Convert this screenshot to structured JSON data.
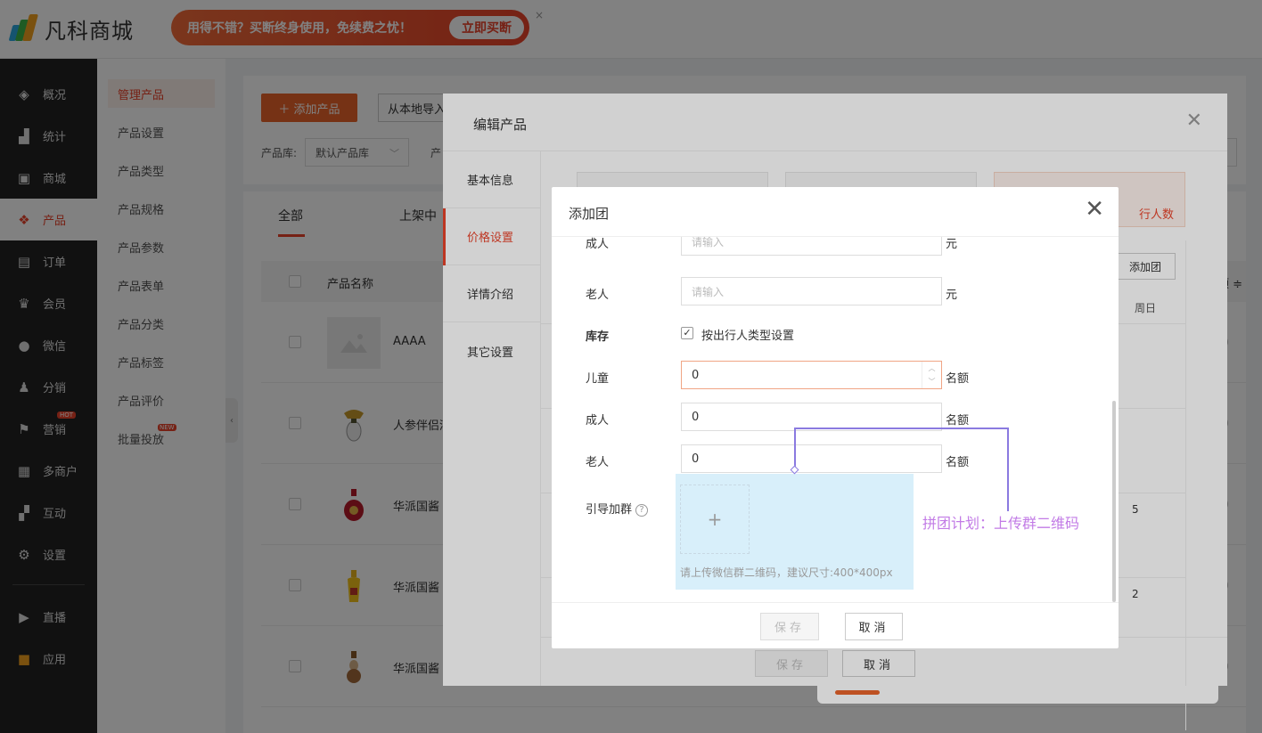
{
  "brand": {
    "name": "凡科商城"
  },
  "banner": {
    "text": "用得不错？买断终身使用，免续费之忧！",
    "button": "立即买断",
    "close": "×"
  },
  "nav": [
    {
      "label": "概况",
      "icon": "layers-icon",
      "glyph": "◈"
    },
    {
      "label": "统计",
      "icon": "chart-icon",
      "glyph": "▟"
    },
    {
      "label": "商城",
      "icon": "store-icon",
      "glyph": "▣"
    },
    {
      "label": "产品",
      "icon": "product-grid-icon",
      "glyph": "❖"
    },
    {
      "label": "订单",
      "icon": "order-icon",
      "glyph": "▤"
    },
    {
      "label": "会员",
      "icon": "crown-icon",
      "glyph": "♛"
    },
    {
      "label": "微信",
      "icon": "wechat-icon",
      "glyph": "●"
    },
    {
      "label": "分销",
      "icon": "users-icon",
      "glyph": "♟"
    },
    {
      "label": "营销",
      "icon": "flag-icon",
      "glyph": "⚑",
      "badge": "HOT"
    },
    {
      "label": "多商户",
      "icon": "merchant-icon",
      "glyph": "▦"
    },
    {
      "label": "互动",
      "icon": "interact-icon",
      "glyph": "▞"
    },
    {
      "label": "设置",
      "icon": "gear-icon",
      "glyph": "⚙"
    },
    {
      "label": "直播",
      "icon": "live-tv-icon",
      "glyph": "▶"
    },
    {
      "label": "应用",
      "icon": "apps-icon",
      "glyph": "■"
    }
  ],
  "subnav": [
    {
      "label": "管理产品"
    },
    {
      "label": "产品设置"
    },
    {
      "label": "产品类型"
    },
    {
      "label": "产品规格"
    },
    {
      "label": "产品参数"
    },
    {
      "label": "产品表单"
    },
    {
      "label": "产品分类"
    },
    {
      "label": "产品标签"
    },
    {
      "label": "产品评价"
    },
    {
      "label": "批量投放",
      "badge": "NEW"
    }
  ],
  "toolbar": {
    "add_label": "＋ 添加产品",
    "import_label": "从本地导入",
    "lib_label": "产品库:",
    "lib_value": "默认产品库",
    "lib2_label": "产"
  },
  "tabs": {
    "all": "全部",
    "on_sale": "上架中"
  },
  "table": {
    "col_name": "产品名称",
    "col_right": "顶 ≑",
    "rows": [
      {
        "name": "AAAA",
        "icon": "image-placeholder-icon"
      },
      {
        "name": "人参伴侣酒",
        "icon": "ginseng-bottle-icon"
      },
      {
        "name": "华派国酱",
        "icon": "red-bottle-icon"
      },
      {
        "name": "华派国酱",
        "icon": "yellow-bottle-icon"
      },
      {
        "name": "华派国酱",
        "icon": "brown-bottle-icon"
      }
    ]
  },
  "edit_modal": {
    "title": "编辑产品",
    "tabs": [
      "基本信息",
      "价格设置",
      "详情介绍",
      "其它设置"
    ],
    "card_hot_text": "行人数",
    "add_group": "添加团",
    "weekday": "周日",
    "row_nums": [
      "5",
      "2"
    ],
    "save": "保存",
    "cancel": "取消"
  },
  "dialog": {
    "title": "添加团",
    "fields": [
      {
        "label": "成人",
        "placeholder": "请输入",
        "unit": "元"
      },
      {
        "label": "老人",
        "placeholder": "请输入",
        "unit": "元"
      }
    ],
    "stock_label": "库存",
    "stock_checkbox": "按出行人类型设置",
    "stock_fields": [
      {
        "label": "儿童",
        "value": "0",
        "unit": "名额"
      },
      {
        "label": "成人",
        "value": "0",
        "unit": "名额"
      },
      {
        "label": "老人",
        "value": "0",
        "unit": "名额"
      }
    ],
    "group_label": "引导加群",
    "upload_plus": "+",
    "upload_hint": "请上传微信群二维码，建议尺寸:400*400px",
    "save": "保存",
    "cancel": "取消"
  },
  "annotation": {
    "text": "拼团计划：上传群二维码"
  }
}
